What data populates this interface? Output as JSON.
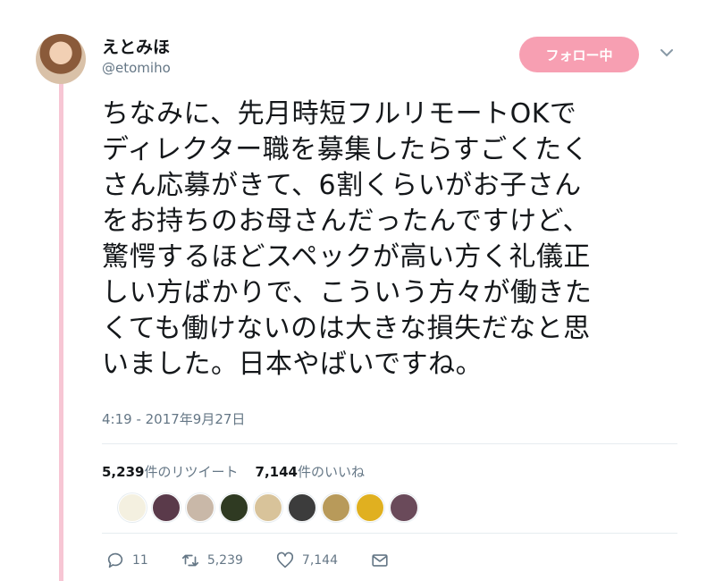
{
  "user": {
    "name": "えとみほ",
    "handle": "@etomiho"
  },
  "follow_button": "フォロー中",
  "tweet": {
    "text": "ちなみに、先月時短フルリモートOKで\nディレクター職を募集したらすごくたく\nさん応募がきて、6割くらいがお子さん\nをお持ちのお母さんだったんですけど、\n驚愕するほどスペックが高い方く礼儀正\nしい方ばかりで、こういう方々が働きた\nくても働けないのは大きな損失だなと思\nいました。日本やばいですね。",
    "timestamp": "4:19 - 2017年9月27日"
  },
  "stats": {
    "retweet_count": "5,239",
    "retweet_label": "件のリツイート",
    "like_count": "7,144",
    "like_label": "件のいいね"
  },
  "liker_avatars": [
    "#f4f0e0",
    "#5a3a4a",
    "#c9b8a8",
    "#2f3a22",
    "#d8c39a",
    "#3c3c3c",
    "#b89a5a",
    "#e0b020",
    "#6a4a5a"
  ],
  "actions": {
    "reply_count": "11",
    "retweet_count": "5,239",
    "like_count": "7,144"
  },
  "colors": {
    "accent_pink": "#f79fb2",
    "thread_line": "#f7c6d4",
    "secondary_text": "#657786"
  }
}
